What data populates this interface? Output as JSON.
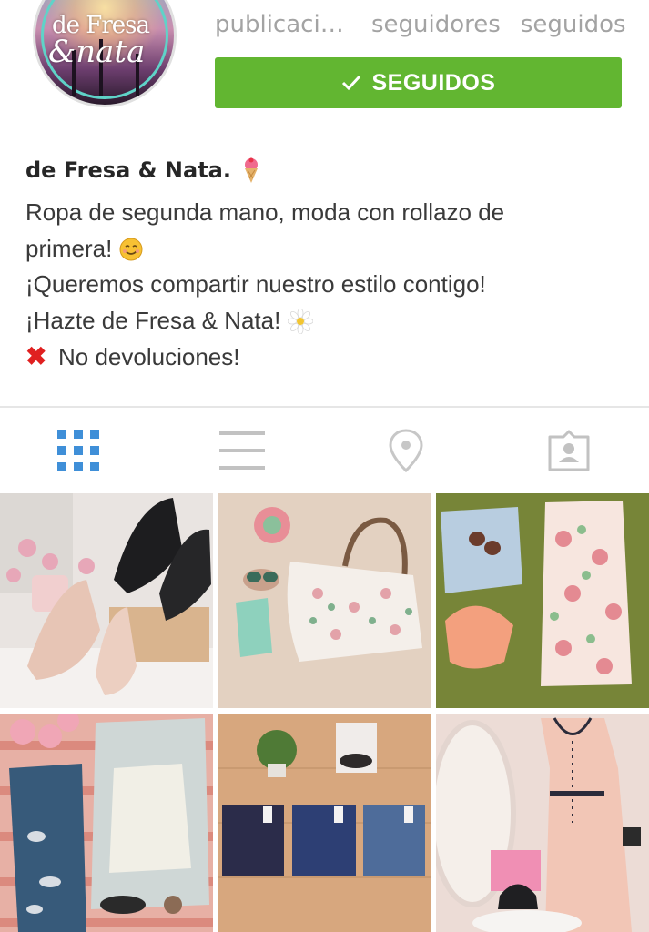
{
  "profile": {
    "avatar_lines": [
      "de Fresa",
      "&nata"
    ],
    "stats": [
      "publicacio...",
      "seguidores",
      "seguidos"
    ],
    "follow_button": "SEGUIDOS",
    "name": "de Fresa & Nata.",
    "bio": [
      "Ropa de segunda mano, moda con rollazo de",
      "primera!",
      "¡Queremos compartir nuestro estilo contigo!",
      "¡Hazte de Fresa & Nata!",
      "No devoluciones!"
    ]
  },
  "tabs": [
    {
      "icon": "grid-icon",
      "active": true
    },
    {
      "icon": "list-icon",
      "active": false
    },
    {
      "icon": "location-pin-icon",
      "active": false
    },
    {
      "icon": "tagged-person-icon",
      "active": false
    }
  ],
  "colors": {
    "accent": "#62b631",
    "active_tab": "#3f8fd8",
    "inactive_tab": "#c7c7c7",
    "stat_text": "#a3a3a3"
  },
  "posts": [
    {
      "subject": "shoes-heels-candle"
    },
    {
      "subject": "floral-bag-sandals"
    },
    {
      "subject": "shorts-floral-dress"
    },
    {
      "subject": "jeans-sweater"
    },
    {
      "subject": "three-jeans-plant"
    },
    {
      "subject": "dress-mirror-heels"
    }
  ]
}
